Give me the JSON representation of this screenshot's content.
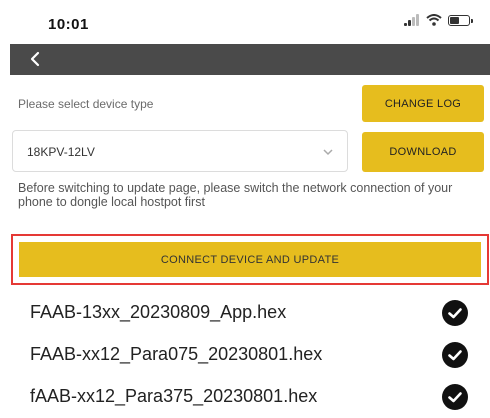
{
  "status": {
    "time": "10:01"
  },
  "device_type": {
    "label": "Please select device type",
    "change_log_label": "CHANGE LOG",
    "selected": "18KPV-12LV",
    "download_label": "DOWNLOAD"
  },
  "notice": "Before switching to update page, please switch the network connection of your phone to dongle local hostpot first",
  "connect_button_label": "CONNECT DEVICE AND UPDATE",
  "files": [
    {
      "name": "FAAB-13xx_20230809_App.hex",
      "icon": "check-icon"
    },
    {
      "name": "FAAB-xx12_Para075_20230801.hex",
      "icon": "check-icon"
    },
    {
      "name": "fAAB-xx12_Para375_20230801.hex",
      "icon": "check-icon"
    }
  ],
  "colors": {
    "accent": "#e6bd1e",
    "nav": "#4a4a4a",
    "highlight": "#e53935"
  }
}
